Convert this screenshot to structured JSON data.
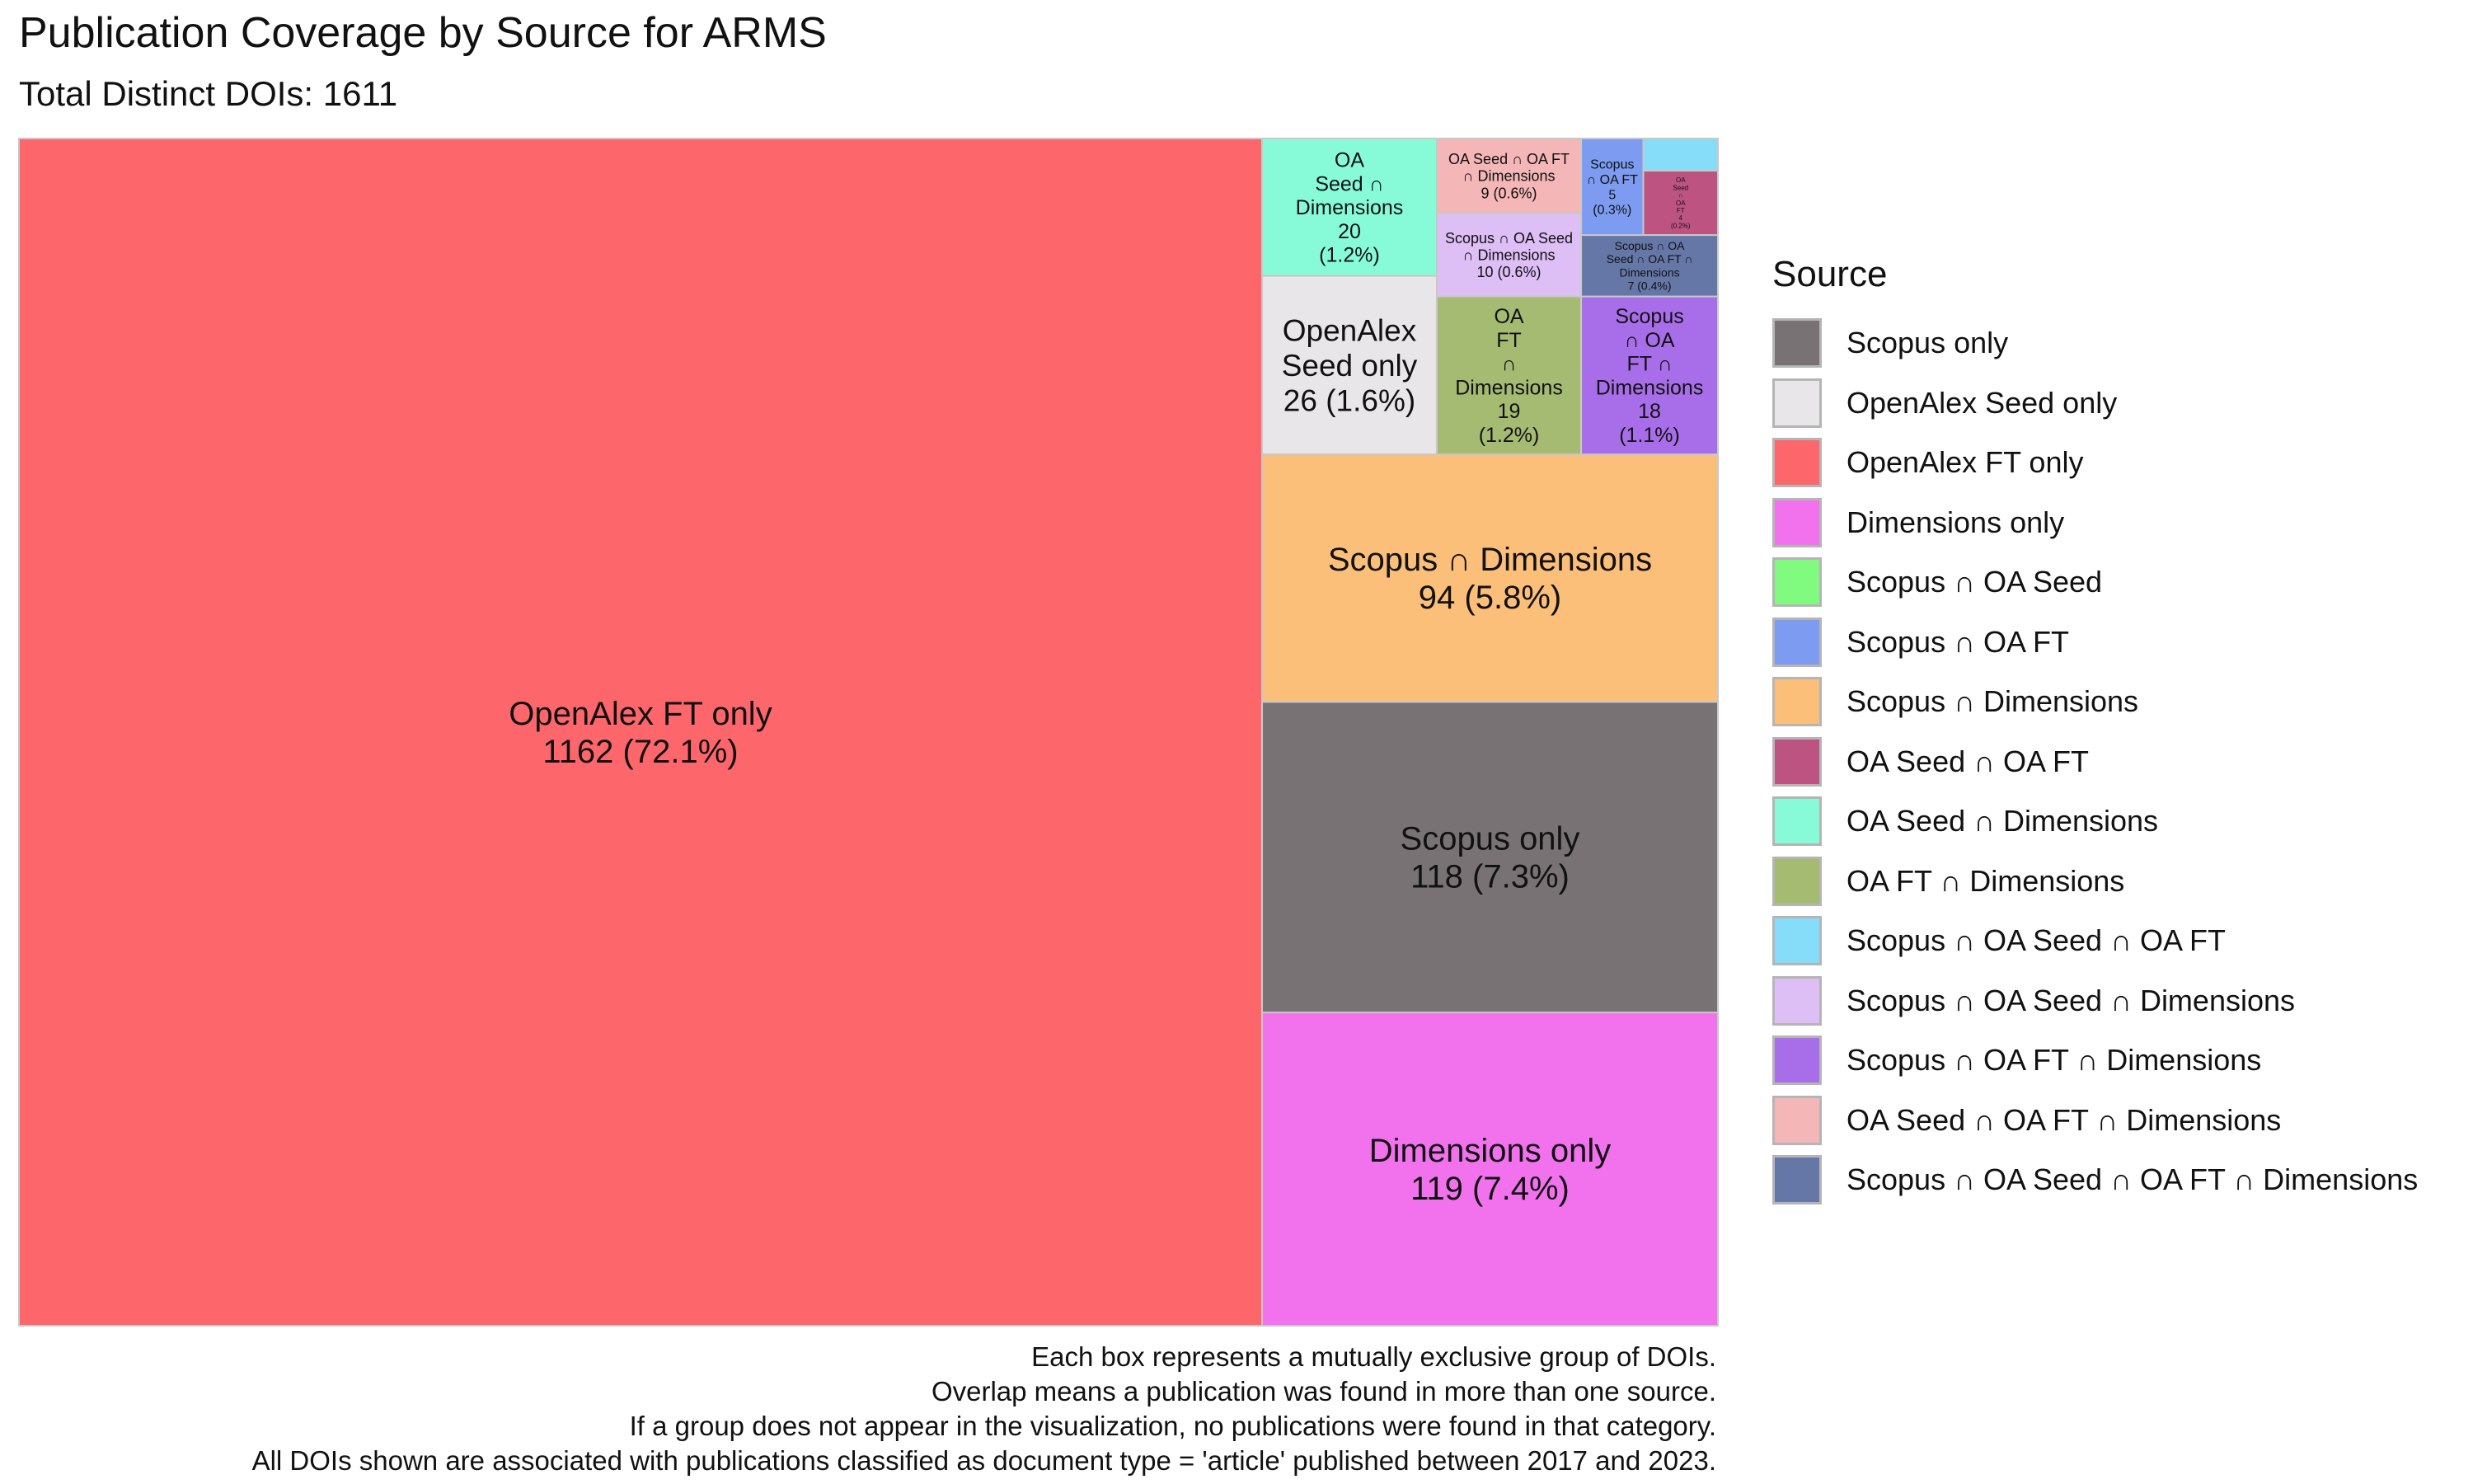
{
  "chart_data": {
    "type": "treemap",
    "title": "Publication Coverage by Source for ARMS",
    "subtitle": "Total Distinct DOIs: 1611",
    "legend": {
      "title": "Source",
      "placement": "right",
      "entries": [
        {
          "label": "Scopus only",
          "color": "#787275"
        },
        {
          "label": "OpenAlex Seed only",
          "color": "#e8e6e9"
        },
        {
          "label": "OpenAlex FT only",
          "color": "#fd666b"
        },
        {
          "label": "Dimensions only",
          "color": "#f272ee"
        },
        {
          "label": "Scopus ∩ OA Seed",
          "color": "#80fb7f"
        },
        {
          "label": "Scopus ∩ OA FT",
          "color": "#7d9cf1"
        },
        {
          "label": "Scopus ∩ Dimensions",
          "color": "#fbbf79"
        },
        {
          "label": "OA Seed ∩ OA FT",
          "color": "#bd5381"
        },
        {
          "label": "OA Seed ∩ Dimensions",
          "color": "#87fbd8"
        },
        {
          "label": "OA FT ∩ Dimensions",
          "color": "#a5bb72"
        },
        {
          "label": "Scopus ∩ OA Seed ∩ OA FT",
          "color": "#86ddfa"
        },
        {
          "label": "Scopus ∩ OA Seed ∩ Dimensions",
          "color": "#ddbef5"
        },
        {
          "label": "Scopus ∩ OA FT ∩ Dimensions",
          "color": "#a86ee9"
        },
        {
          "label": "OA Seed ∩ OA FT ∩ Dimensions",
          "color": "#f4b6b7"
        },
        {
          "label": "Scopus ∩ OA Seed ∩ OA FT ∩ Dimensions",
          "color": "#6577a6"
        }
      ]
    },
    "groups": [
      {
        "label": "OpenAlex FT only",
        "value": 1162,
        "percent": "72.1%",
        "tile_lines": [
          "OpenAlex FT only",
          "1162 (72.1%)"
        ],
        "color": "#fd666b"
      },
      {
        "label": "Dimensions only",
        "value": 119,
        "percent": "7.4%",
        "tile_lines": [
          "Dimensions only",
          "119 (7.4%)"
        ],
        "color": "#f272ee"
      },
      {
        "label": "Scopus only",
        "value": 118,
        "percent": "7.3%",
        "tile_lines": [
          "Scopus only",
          "118 (7.3%)"
        ],
        "color": "#787275"
      },
      {
        "label": "Scopus ∩ Dimensions",
        "value": 94,
        "percent": "5.8%",
        "tile_lines": [
          "Scopus ∩ Dimensions",
          "94 (5.8%)"
        ],
        "color": "#fbbf79"
      },
      {
        "label": "OpenAlex Seed only",
        "value": 26,
        "percent": "1.6%",
        "tile_lines": [
          "OpenAlex",
          "Seed only",
          "26 (1.6%)"
        ],
        "color": "#e8e6e9"
      },
      {
        "label": "OA Seed ∩ Dimensions",
        "value": 20,
        "percent": "1.2%",
        "tile_lines": [
          "OA",
          "Seed ∩",
          "Dimensions",
          "20",
          "(1.2%)"
        ],
        "color": "#87fbd8"
      },
      {
        "label": "OA FT ∩ Dimensions",
        "value": 19,
        "percent": "1.2%",
        "tile_lines": [
          "OA",
          "FT",
          "∩",
          "Dimensions",
          "19",
          "(1.2%)"
        ],
        "color": "#a5bb72"
      },
      {
        "label": "Scopus ∩ OA FT ∩ Dimensions",
        "value": 18,
        "percent": "1.1%",
        "tile_lines": [
          "Scopus",
          "∩ OA",
          "FT ∩",
          "Dimensions",
          "18",
          "(1.1%)"
        ],
        "color": "#a86ee9"
      },
      {
        "label": "Scopus ∩ OA Seed ∩ Dimensions",
        "value": 10,
        "percent": "0.6%",
        "tile_lines": [
          "Scopus ∩ OA Seed",
          "∩ Dimensions",
          "10 (0.6%)"
        ],
        "color": "#ddbef5"
      },
      {
        "label": "OA Seed ∩ OA FT ∩ Dimensions",
        "value": 9,
        "percent": "0.6%",
        "tile_lines": [
          "OA Seed ∩ OA FT",
          "∩ Dimensions",
          "9 (0.6%)"
        ],
        "color": "#f4b6b7"
      },
      {
        "label": "Scopus ∩ OA Seed ∩ OA FT ∩ Dimensions",
        "value": 7,
        "percent": "0.4%",
        "tile_lines": [
          "Scopus ∩ OA",
          "Seed ∩ OA FT ∩",
          "Dimensions",
          "7 (0.4%)"
        ],
        "color": "#6577a6"
      },
      {
        "label": "Scopus ∩ OA FT",
        "value": 5,
        "percent": "0.3%",
        "tile_lines": [
          "Scopus",
          "∩ OA FT",
          "5",
          "(0.3%)"
        ],
        "color": "#7d9cf1"
      },
      {
        "label": "OA Seed ∩ OA FT",
        "value": 4,
        "percent": "0.2%",
        "tile_lines": [
          "OA",
          "Seed",
          "∩",
          "OA",
          "FT",
          "4",
          "(0.2%)"
        ],
        "color": "#bd5381"
      },
      {
        "label": "Scopus ∩ OA Seed ∩ OA FT",
        "value": 2,
        "percent": "0.1%",
        "tile_lines": [],
        "color": "#86ddfa"
      }
    ],
    "footnotes": [
      "Each box represents a mutually exclusive group of DOIs.",
      "Overlap means a publication was found in more than one source.",
      "If a group does not appear in the visualization, no publications were found in that category.",
      "All DOIs shown are associated with publications classified as document type = 'article' published between 2017 and 2023."
    ]
  }
}
